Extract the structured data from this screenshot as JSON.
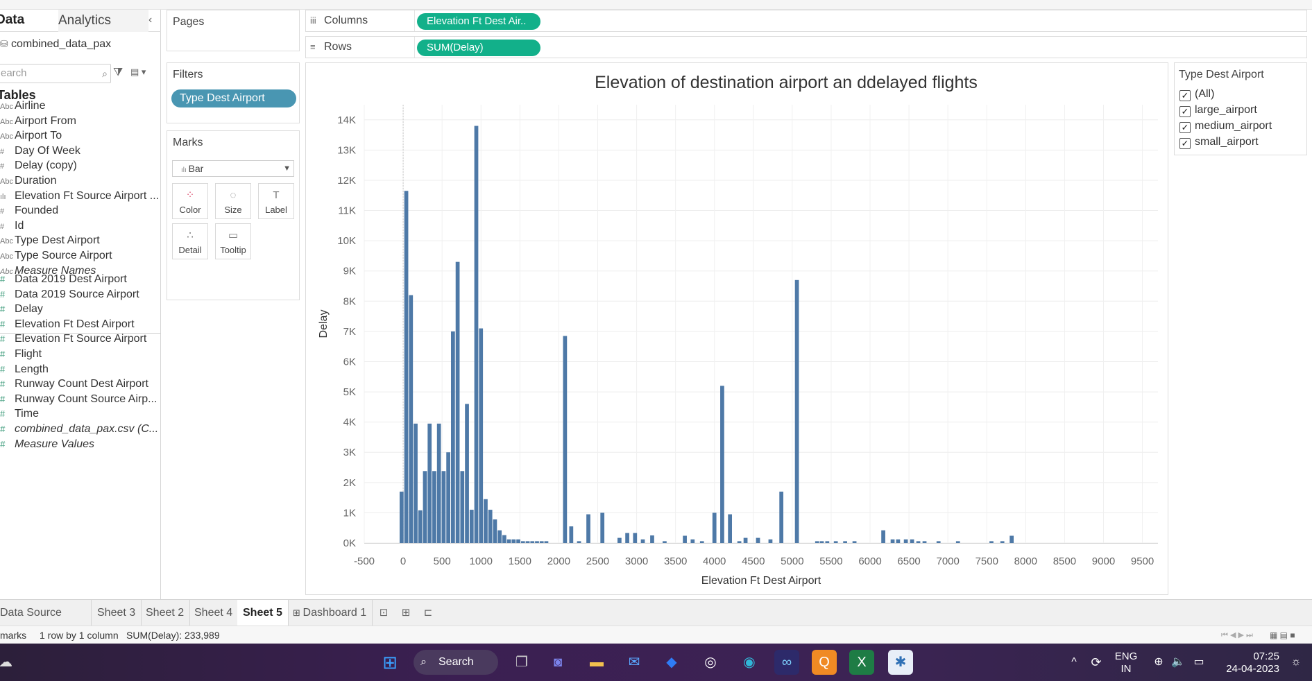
{
  "datapane": {
    "tab_data": "Data",
    "tab_analytics": "Analytics",
    "collapse": "‹",
    "datasource": "combined_data_pax",
    "search_placeholder": "earch",
    "tables_header": "Tables",
    "dimensions": [
      {
        "type": "Abc",
        "label": "Airline"
      },
      {
        "type": "Abc",
        "label": "Airport From"
      },
      {
        "type": "Abc",
        "label": "Airport To"
      },
      {
        "type": "#",
        "label": "Day Of Week"
      },
      {
        "type": "#",
        "label": "Delay (copy)"
      },
      {
        "type": "Abc",
        "label": "Duration"
      },
      {
        "type": "ılı",
        "label": "Elevation Ft Source Airport ..."
      },
      {
        "type": "#",
        "label": "Founded"
      },
      {
        "type": "#",
        "label": "Id"
      },
      {
        "type": "Abc",
        "label": "Type Dest Airport"
      },
      {
        "type": "Abc",
        "label": "Type Source Airport"
      },
      {
        "type": "Abc",
        "label": "Measure Names"
      }
    ],
    "measures": [
      {
        "type": "#",
        "label": "Data 2019 Dest Airport"
      },
      {
        "type": "#",
        "label": "Data 2019 Source Airport"
      },
      {
        "type": "#",
        "label": "Delay"
      },
      {
        "type": "#",
        "label": "Elevation Ft Dest Airport"
      },
      {
        "type": "#",
        "label": "Elevation Ft Source Airport"
      },
      {
        "type": "#",
        "label": "Flight"
      },
      {
        "type": "#",
        "label": "Length"
      },
      {
        "type": "#",
        "label": "Runway Count Dest Airport"
      },
      {
        "type": "#",
        "label": "Runway Count Source Airp..."
      },
      {
        "type": "#",
        "label": "Time"
      },
      {
        "type": "#",
        "label": "combined_data_pax.csv (C..."
      },
      {
        "type": "#",
        "label": "Measure Values"
      }
    ]
  },
  "cards": {
    "pages": "Pages",
    "filters": "Filters",
    "filter_pill": "Type Dest Airport",
    "marks": "Marks",
    "mark_type": "Bar",
    "mark_buttons": [
      "Color",
      "Size",
      "Label",
      "Detail",
      "Tooltip"
    ]
  },
  "shelves": {
    "columns_label": "Columns",
    "columns_pill": "Elevation Ft Dest Air..",
    "rows_label": "Rows",
    "rows_pill": "SUM(Delay)"
  },
  "legend": {
    "title": "Type Dest Airport",
    "items": [
      "(All)",
      "large_airport",
      "medium_airport",
      "small_airport"
    ]
  },
  "sheet_tabs": [
    "Data Source",
    "Sheet 3",
    "Sheet 2",
    "Sheet 4",
    "Sheet 5",
    "Dashboard 1"
  ],
  "active_sheet": "Sheet 5",
  "status": {
    "marks": "marks",
    "dims": "1 row by 1 column",
    "sum": "SUM(Delay): 233,989"
  },
  "taskbar": {
    "search": "Search",
    "lang1": "ENG",
    "lang2": "IN",
    "time": "07:25",
    "date": "24-04-2023"
  },
  "colors": {
    "bar": "#4e79a7",
    "pill_green": "#12b08a",
    "pill_blue": "#4996b2"
  },
  "chart_data": {
    "type": "bar",
    "title": "Elevation of destination airport an ddelayed flights",
    "xlabel": "Elevation Ft Dest Airport",
    "ylabel": "Delay",
    "xlim": [
      -500,
      9700
    ],
    "ylim": [
      0,
      14500
    ],
    "xticks": [
      -500,
      0,
      500,
      1000,
      1500,
      2000,
      2500,
      3000,
      3500,
      4000,
      4500,
      5000,
      5500,
      6000,
      6500,
      7000,
      7500,
      8000,
      8500,
      9000,
      9500
    ],
    "xtick_labels": [
      "-500",
      "0",
      "500",
      "1000",
      "1500",
      "2000",
      "2500",
      "3000",
      "3500",
      "4000",
      "4500",
      "5000",
      "5500",
      "6000",
      "6500",
      "7000",
      "7500",
      "8000",
      "8500",
      "9000",
      "9500"
    ],
    "yticks": [
      0,
      1000,
      2000,
      3000,
      4000,
      5000,
      6000,
      7000,
      8000,
      9000,
      10000,
      11000,
      12000,
      13000,
      14000
    ],
    "ytick_labels": [
      "0K",
      "1K",
      "2K",
      "3K",
      "4K",
      "5K",
      "6K",
      "7K",
      "8K",
      "9K",
      "10K",
      "11K",
      "12K",
      "13K",
      "14K"
    ],
    "grid": true,
    "bin_width": 60,
    "x": [
      -80,
      -20,
      40,
      100,
      160,
      220,
      280,
      340,
      400,
      460,
      520,
      580,
      640,
      700,
      760,
      820,
      880,
      940,
      1000,
      1060,
      1120,
      1180,
      1240,
      1300,
      1360,
      1420,
      1480,
      1540,
      1600,
      1660,
      1720,
      1780,
      1840,
      2080,
      2160,
      2260,
      2380,
      2560,
      2780,
      2880,
      2980,
      3080,
      3200,
      3360,
      3620,
      3720,
      3840,
      4000,
      4100,
      4200,
      4320,
      4400,
      4560,
      4720,
      4860,
      5060,
      5320,
      5380,
      5450,
      5560,
      5680,
      5800,
      6170,
      6290,
      6360,
      6460,
      6540,
      6620,
      6700,
      6880,
      7130,
      7560,
      7700,
      7820
    ],
    "values": [
      0,
      1700,
      11650,
      8200,
      3950,
      1080,
      2380,
      3950,
      2380,
      3950,
      2380,
      3000,
      7000,
      9300,
      2380,
      4600,
      1100,
      13800,
      7100,
      1450,
      1100,
      780,
      420,
      260,
      120,
      120,
      120,
      60,
      60,
      60,
      60,
      60,
      60,
      6850,
      550,
      60,
      950,
      1000,
      170,
      330,
      330,
      120,
      250,
      60,
      240,
      120,
      60,
      1000,
      5200,
      950,
      60,
      170,
      170,
      120,
      1700,
      8700,
      60,
      60,
      60,
      60,
      60,
      60,
      420,
      120,
      120,
      120,
      120,
      60,
      60,
      60,
      60,
      60,
      60,
      240
    ]
  }
}
